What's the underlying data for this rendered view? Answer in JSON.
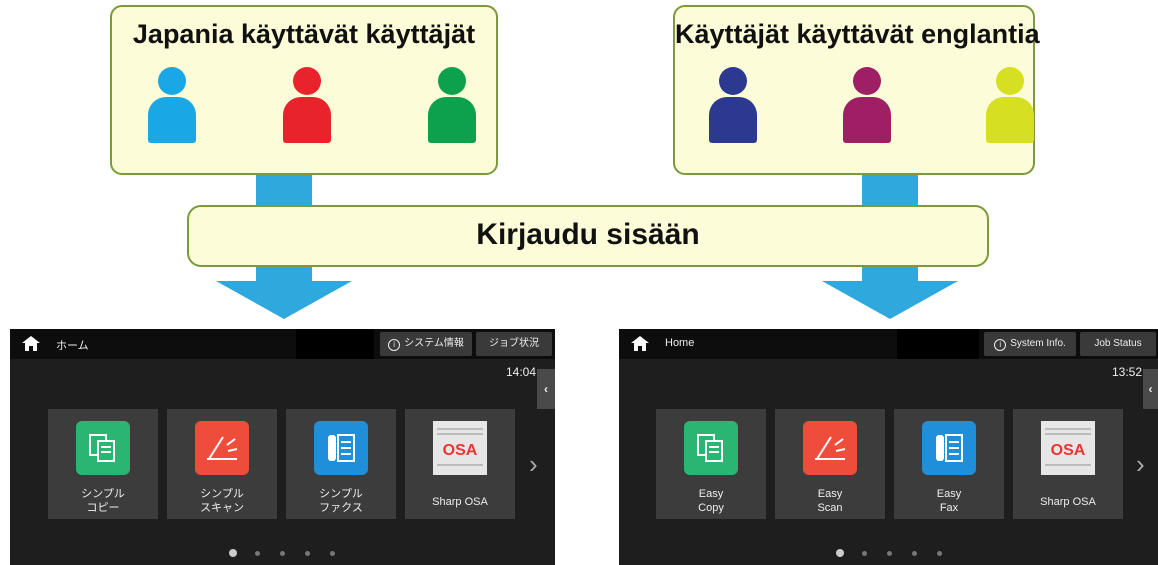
{
  "groups": {
    "japanese": {
      "title": "Japania käyttävät käyttäjät"
    },
    "english": {
      "title": "Käyttäjät käyttävät englantia"
    }
  },
  "login": {
    "label": "Kirjaudu sisään"
  },
  "screens": {
    "japanese": {
      "home_label": "ホーム",
      "system_info": "システム情報",
      "job_status": "ジョブ状況",
      "clock": "14:04",
      "tiles": [
        {
          "icon": "copy-icon",
          "line1": "シンプル",
          "line2": "コピー",
          "color": "#2bb573"
        },
        {
          "icon": "scan-icon",
          "line1": "シンプル",
          "line2": "スキャン",
          "color": "#ef4d3c"
        },
        {
          "icon": "fax-icon",
          "line1": "シンプル",
          "line2": "ファクス",
          "color": "#1e8fd8"
        },
        {
          "icon": "sharp-osa-icon",
          "line1": "Sharp OSA",
          "line2": "",
          "color": "#d9d9d9"
        }
      ]
    },
    "english": {
      "home_label": "Home",
      "system_info": "System Info.",
      "job_status": "Job Status",
      "clock": "13:52",
      "tiles": [
        {
          "icon": "copy-icon",
          "line1": "Easy",
          "line2": "Copy",
          "color": "#2bb573"
        },
        {
          "icon": "scan-icon",
          "line1": "Easy",
          "line2": "Scan",
          "color": "#ef4d3c"
        },
        {
          "icon": "fax-icon",
          "line1": "Easy",
          "line2": "Fax",
          "color": "#1e8fd8"
        },
        {
          "icon": "sharp-osa-icon",
          "line1": "Sharp OSA",
          "line2": "",
          "color": "#d9d9d9"
        }
      ]
    }
  },
  "colors": {
    "box_fill": "#fcfcd8",
    "box_border": "#7a9a3b",
    "arrow": "#2fa8dd",
    "persons_japanese": [
      "#1aa7e6",
      "#e8232b",
      "#0ea14d"
    ],
    "persons_english": [
      "#2b3990",
      "#9e1f63",
      "#d7df23"
    ]
  },
  "osa_logo_text": "OSA"
}
